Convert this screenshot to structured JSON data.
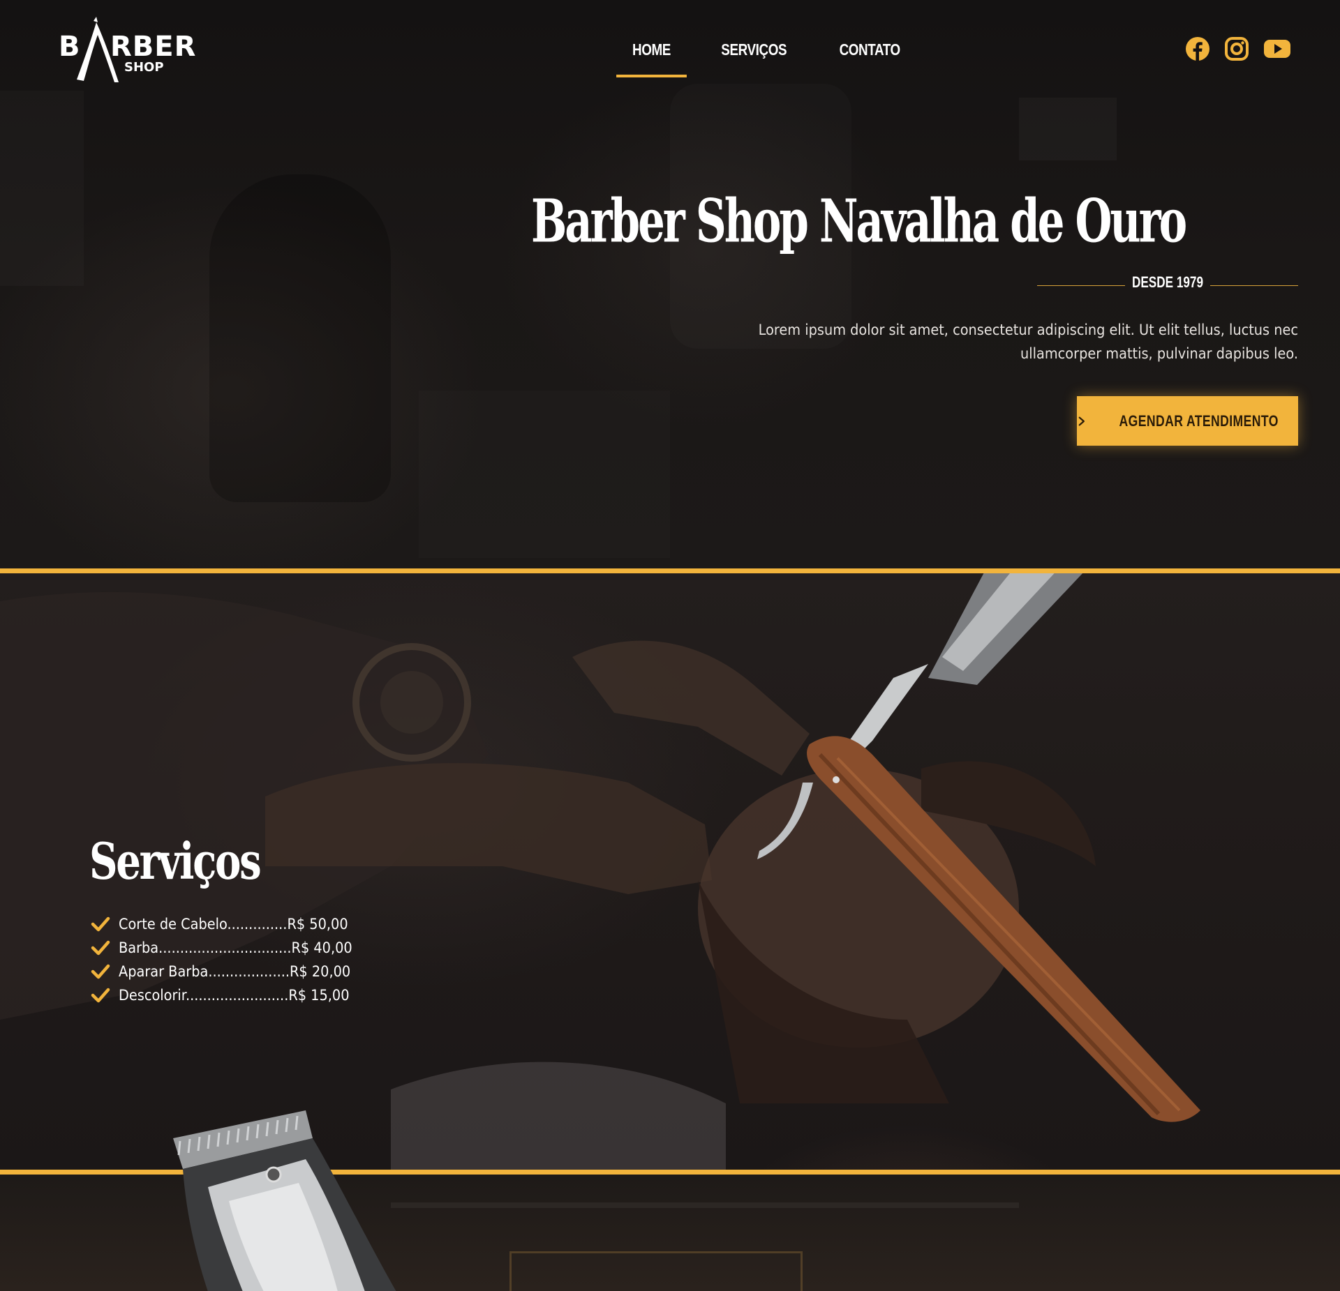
{
  "brand": {
    "logo_letter_b": "B",
    "logo_letters_rber": "RBER",
    "logo_sub": "SHOP",
    "accent_color": "#f2b43c"
  },
  "nav": {
    "items": [
      {
        "label": "HOME",
        "active": true
      },
      {
        "label": "SERVIÇOS",
        "active": false
      },
      {
        "label": "CONTATO",
        "active": false
      }
    ]
  },
  "social": {
    "icons": [
      "facebook-icon",
      "instagram-icon",
      "youtube-icon"
    ]
  },
  "hero": {
    "title": "Barber Shop Navalha de Ouro",
    "since": "DESDE 1979",
    "description": "Lorem ipsum dolor sit amet, consectetur adipiscing elit. Ut elit tellus, luctus nec ullamcorper mattis, pulvinar dapibus leo.",
    "cta_label": "AGENDAR ATENDIMENTO",
    "cta_icon": "chevron-right-icon"
  },
  "services": {
    "title": "Serviços",
    "items": [
      "Corte de Cabelo..............R$ 50,00",
      "Barba...............................R$ 40,00",
      "Aparar Barba...................R$ 20,00",
      "Descolorir........................R$ 15,00"
    ],
    "item_icon": "check-icon"
  }
}
